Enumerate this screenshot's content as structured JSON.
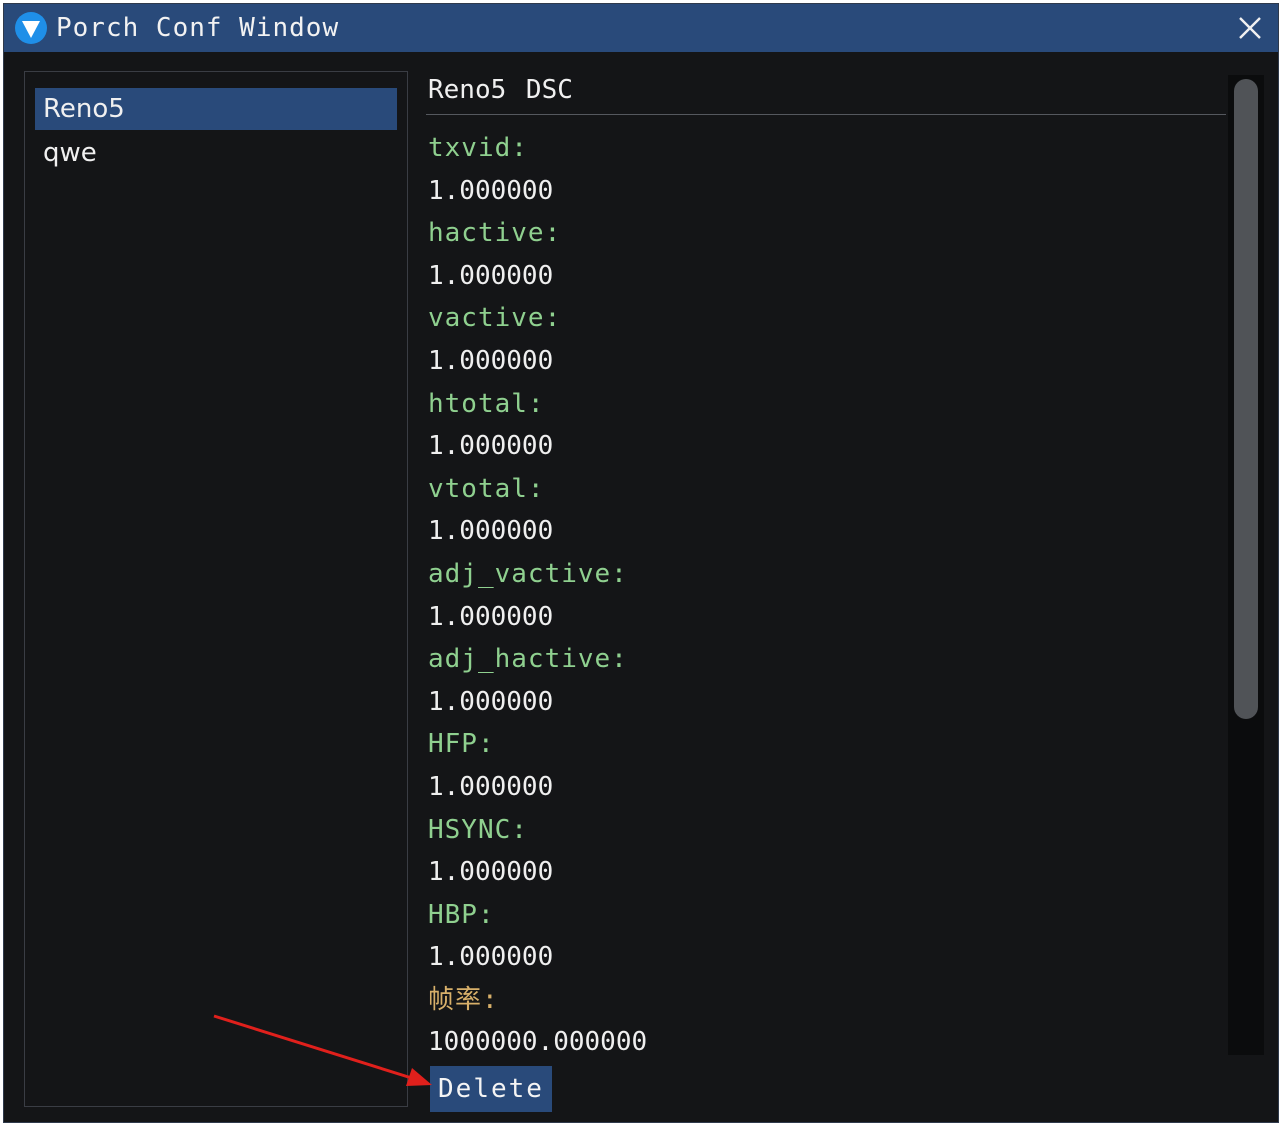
{
  "window": {
    "title": "Porch Conf Window"
  },
  "left_list": {
    "items": [
      {
        "label": "Reno5",
        "selected": true
      },
      {
        "label": "qwe",
        "selected": false
      }
    ]
  },
  "detail": {
    "header": "Reno5 DSC",
    "fields": [
      {
        "label": "txvid:",
        "value": "1.000000"
      },
      {
        "label": "hactive:",
        "value": "1.000000"
      },
      {
        "label": "vactive:",
        "value": "1.000000"
      },
      {
        "label": "htotal:",
        "value": "1.000000"
      },
      {
        "label": "vtotal:",
        "value": "1.000000"
      },
      {
        "label": "adj_vactive:",
        "value": "1.000000"
      },
      {
        "label": "adj_hactive:",
        "value": "1.000000"
      },
      {
        "label": "HFP:",
        "value": "1.000000"
      },
      {
        "label": "HSYNC:",
        "value": "1.000000"
      },
      {
        "label": "HBP:",
        "value": "1.000000"
      },
      {
        "label": "帧率:",
        "value": "1000000.000000"
      }
    ],
    "delete_label": "Delete"
  },
  "colors": {
    "accent": "#294a7a",
    "label_green": "#8fd08f",
    "label_cjk": "#d8b06a",
    "annotation_arrow": "#e0201c"
  },
  "icons": {
    "logo": "app-logo-icon",
    "close": "close-icon"
  }
}
